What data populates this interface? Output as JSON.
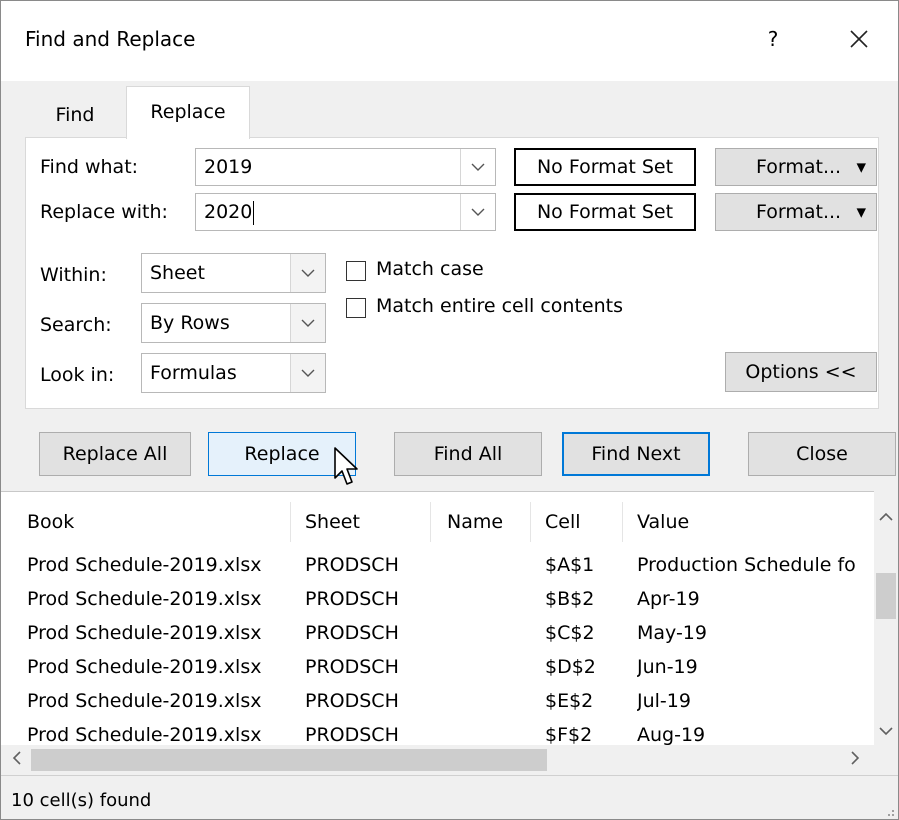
{
  "dialog": {
    "title": "Find and Replace",
    "help": "?"
  },
  "tabs": {
    "find": "Find",
    "replace": "Replace"
  },
  "replace_panel": {
    "find_what_label": "Find what:",
    "find_what_value": "2019",
    "replace_with_label": "Replace with:",
    "replace_with_value": "2020",
    "no_format_1": "No Format Set",
    "no_format_2": "No Format Set",
    "format_label": "Format...",
    "within_label": "Within:",
    "within_value": "Sheet",
    "search_label": "Search:",
    "search_value": "By Rows",
    "look_in_label": "Look in:",
    "look_in_value": "Formulas",
    "match_case": "Match case",
    "match_entire": "Match entire cell contents",
    "options": "Options <<"
  },
  "buttons": {
    "replace_all": "Replace All",
    "replace": "Replace",
    "find_all": "Find All",
    "find_next": "Find Next",
    "close": "Close"
  },
  "results": {
    "columns": [
      "Book",
      "Sheet",
      "Name",
      "Cell",
      "Value"
    ],
    "rows": [
      {
        "book": "Prod Schedule-2019.xlsx",
        "sheet": "PRODSCH",
        "name": "",
        "cell": "$A$1",
        "value": "Production Schedule fo"
      },
      {
        "book": "Prod Schedule-2019.xlsx",
        "sheet": "PRODSCH",
        "name": "",
        "cell": "$B$2",
        "value": "Apr-19"
      },
      {
        "book": "Prod Schedule-2019.xlsx",
        "sheet": "PRODSCH",
        "name": "",
        "cell": "$C$2",
        "value": "May-19"
      },
      {
        "book": "Prod Schedule-2019.xlsx",
        "sheet": "PRODSCH",
        "name": "",
        "cell": "$D$2",
        "value": "Jun-19"
      },
      {
        "book": "Prod Schedule-2019.xlsx",
        "sheet": "PRODSCH",
        "name": "",
        "cell": "$E$2",
        "value": "Jul-19"
      },
      {
        "book": "Prod Schedule-2019.xlsx",
        "sheet": "PRODSCH",
        "name": "",
        "cell": "$F$2",
        "value": "Aug-19"
      }
    ]
  },
  "status": {
    "text": "10 cell(s) found"
  }
}
